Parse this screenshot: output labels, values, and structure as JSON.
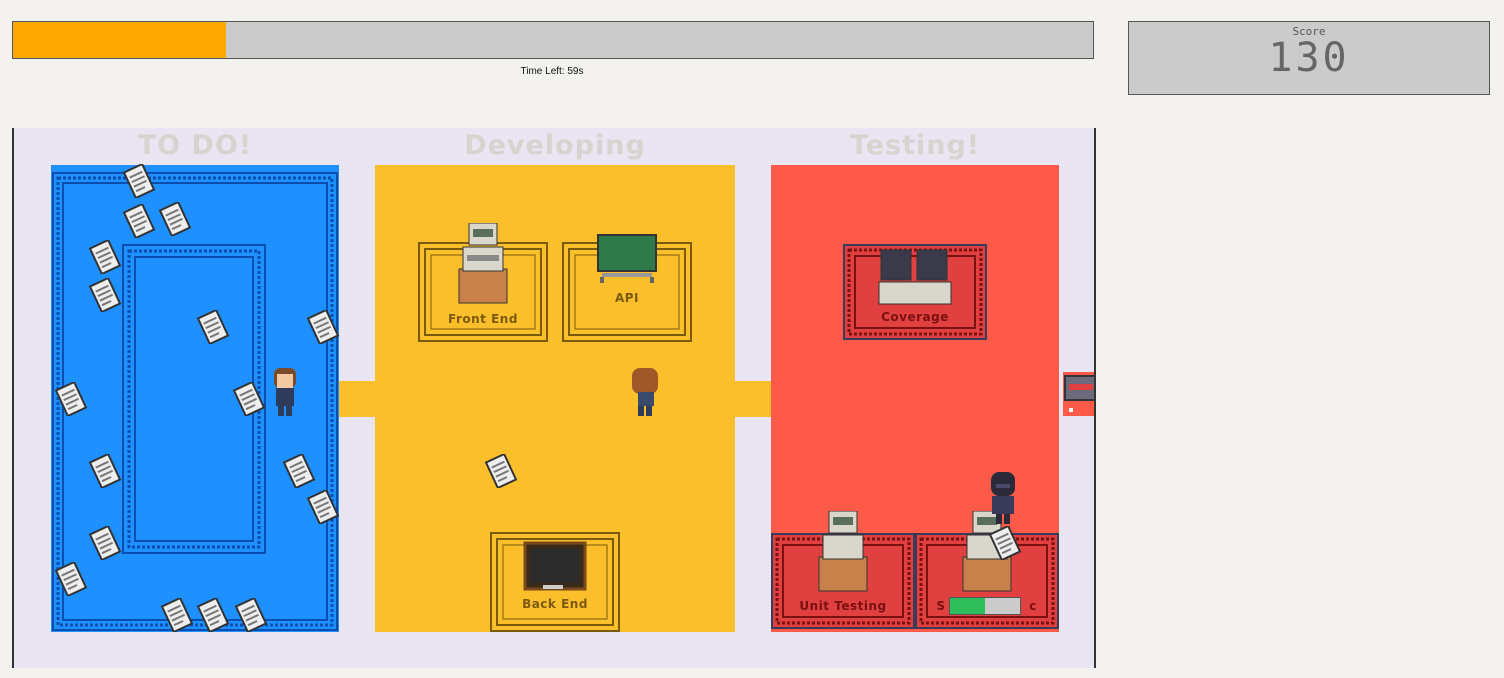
{
  "timer": {
    "text": "Time Left: 59s",
    "progress": 0.197
  },
  "score": {
    "label": "Score",
    "value": "130"
  },
  "board": {
    "columns": [
      {
        "title": "TO DO!",
        "color": "#1e90ff"
      },
      {
        "title": "Developing",
        "color": "#fbbf2c"
      },
      {
        "title": "Testing!",
        "color": "#fe5a4a"
      }
    ],
    "stations": {
      "front_end": "Front End",
      "api": "API",
      "back_end": "Back End",
      "coverage": "Coverage",
      "unit_testing": "Unit Testing",
      "station_6": "S",
      "station_6_tail": "c"
    },
    "station_progress": 0.5
  },
  "colors": {
    "accent": "#ffa800",
    "todo": "#1e90ff",
    "developing": "#fbbf2c",
    "testing": "#fe5a4a",
    "progress_green": "#2ebd5a"
  }
}
